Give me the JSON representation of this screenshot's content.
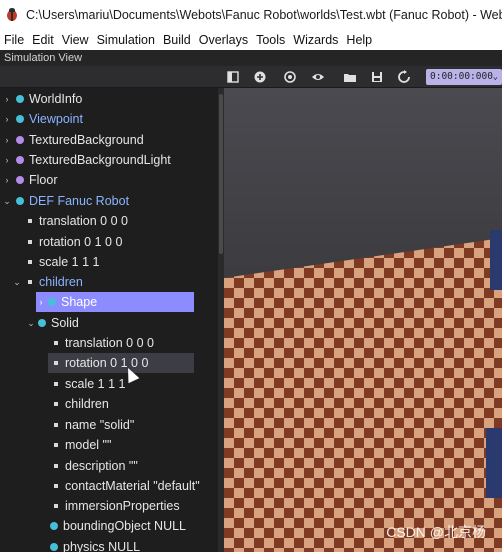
{
  "window": {
    "title": "C:\\Users\\mariu\\Documents\\Webots\\Fanuc Robot\\worlds\\Test.wbt (Fanuc Robot) - Webots R"
  },
  "menu": [
    "File",
    "Edit",
    "View",
    "Simulation",
    "Build",
    "Overlays",
    "Tools",
    "Wizards",
    "Help"
  ],
  "panel": {
    "title": "Simulation View"
  },
  "toolbar": {
    "time": "0:00:00:000",
    "icons": [
      "toggle-panel-icon",
      "add-node-icon",
      "reload-world-icon",
      "eye-icon",
      "open-folder-icon",
      "save-icon",
      "reset-icon"
    ]
  },
  "tree": {
    "nodes": [
      {
        "label": "WorldInfo"
      },
      {
        "label": "Viewpoint"
      },
      {
        "label": "TexturedBackground"
      },
      {
        "label": "TexturedBackgroundLight"
      },
      {
        "label": "Floor"
      },
      {
        "label": "DEF Fanuc Robot"
      },
      {
        "label": "translation 0 0 0"
      },
      {
        "label": "rotation 0 1 0 0"
      },
      {
        "label": "scale 1 1 1"
      },
      {
        "label": "children"
      },
      {
        "label": "Shape"
      },
      {
        "label": "Solid"
      },
      {
        "label": "translation 0 0 0"
      },
      {
        "label": "rotation 0 1 0 0"
      },
      {
        "label": "scale 1 1 1"
      },
      {
        "label": "children"
      },
      {
        "label": "name \"solid\""
      },
      {
        "label": "model \"\""
      },
      {
        "label": "description \"\""
      },
      {
        "label": "contactMaterial \"default\""
      },
      {
        "label": "immersionProperties"
      },
      {
        "label": "boundingObject NULL"
      },
      {
        "label": "physics NULL"
      }
    ]
  },
  "colors": {
    "floor_light": "#d9a27e",
    "floor_dark": "#7e3a22",
    "accent_selection": "#8c8cff",
    "time_box": "#b9b3ea"
  },
  "watermark": "CSDN @北京杨"
}
